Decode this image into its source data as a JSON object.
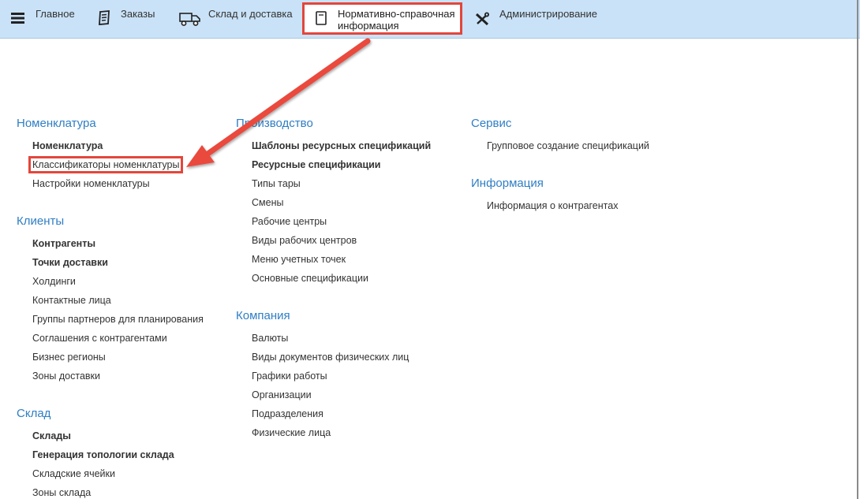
{
  "nav": {
    "items": [
      {
        "label": "Главное",
        "icon": "hamburger-icon"
      },
      {
        "label": "Заказы",
        "icon": "orders-icon"
      },
      {
        "label": "Склад и доставка",
        "icon": "truck-icon"
      },
      {
        "label": "Нормативно-справочная\nинформация",
        "icon": "reference-book-icon",
        "active": true
      },
      {
        "label": "Администрирование",
        "icon": "tools-icon"
      }
    ]
  },
  "sections": {
    "nomenclature": {
      "title": "Номенклатура",
      "links": [
        "Номенклатура",
        "Классификаторы номенклатуры",
        "Настройки номенклатуры"
      ]
    },
    "clients": {
      "title": "Клиенты",
      "links": [
        "Контрагенты",
        "Точки доставки",
        "Холдинги",
        "Контактные лица",
        "Группы партнеров для планирования",
        "Соглашения с контрагентами",
        "Бизнес регионы",
        "Зоны доставки"
      ]
    },
    "warehouse": {
      "title": "Склад",
      "links": [
        "Склады",
        "Генерация топологии склада",
        "Складские ячейки",
        "Зоны склада"
      ]
    },
    "production": {
      "title": "Производство",
      "links": [
        "Шаблоны ресурсных спецификаций",
        "Ресурсные спецификации",
        "Типы тары",
        "Смены",
        "Рабочие центры",
        "Виды рабочих центров",
        "Меню учетных точек",
        "Основные спецификации"
      ]
    },
    "company": {
      "title": "Компания",
      "links": [
        "Валюты",
        "Виды документов физических лиц",
        "Графики работы",
        "Организации",
        "Подразделения",
        "Физические лица"
      ]
    },
    "service": {
      "title": "Сервис",
      "links": [
        "Групповое создание спецификаций"
      ]
    },
    "info": {
      "title": "Информация",
      "links": [
        "Информация о контрагентах"
      ]
    }
  },
  "colors": {
    "topbar": "#c9e2f7",
    "section_title": "#2f7ec4",
    "highlight": "#e3463b"
  }
}
